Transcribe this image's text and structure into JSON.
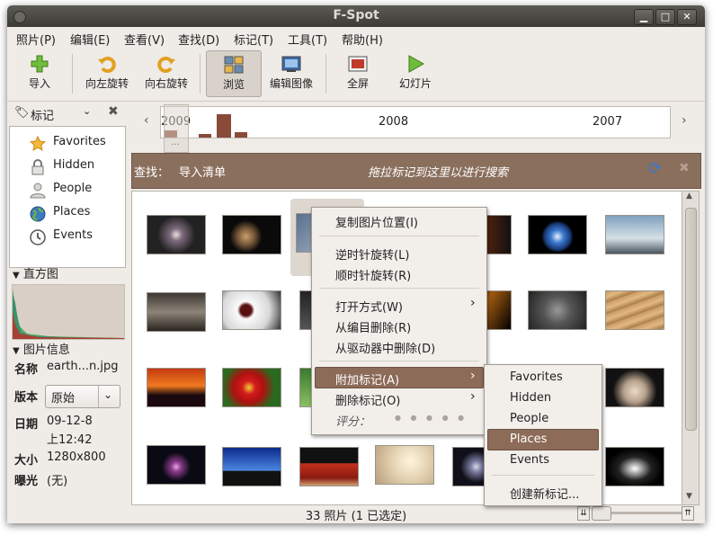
{
  "window": {
    "title": "F-Spot"
  },
  "menubar": [
    "照片(P)",
    "编辑(E)",
    "查看(V)",
    "查找(D)",
    "标记(T)",
    "工具(T)",
    "帮助(H)"
  ],
  "toolbar": {
    "import": "导入",
    "rotate_left": "向左旋转",
    "rotate_right": "向右旋转",
    "browse": "浏览",
    "edit_image": "编辑图像",
    "fullscreen": "全屏",
    "slideshow": "幻灯片"
  },
  "sidebar": {
    "header": "标记",
    "tags": [
      {
        "label": "Favorites",
        "icon": "star-icon"
      },
      {
        "label": "Hidden",
        "icon": "lock-icon"
      },
      {
        "label": "People",
        "icon": "people-icon"
      },
      {
        "label": "Places",
        "icon": "globe-icon"
      },
      {
        "label": "Events",
        "icon": "clock-icon"
      }
    ],
    "histogram_label": "直方图",
    "info_label": "图片信息",
    "info": {
      "name_label": "名称",
      "name_value": "earth...n.jpg",
      "version_label": "版本",
      "version_value": "原始",
      "date_label": "日期",
      "date_value": "09-12-8",
      "time_value": "上12:42",
      "size_label": "大小",
      "size_value": "1280x800",
      "exposure_label": "曝光",
      "exposure_value": "(无)"
    }
  },
  "timeline": {
    "years": [
      "2009",
      "2008",
      "2007"
    ],
    "marker": "..."
  },
  "findbar": {
    "label": "查找：",
    "import_list": "导入清单",
    "hint": "拖拉标记到这里以进行搜索"
  },
  "status": {
    "text": "33 照片 (1 已选定)"
  },
  "context_menu": {
    "items": [
      "复制图片位置(I)",
      "逆时针旋转(L)",
      "顺时针旋转(R)",
      "打开方式(W)",
      "从编目删除(R)",
      "从驱动器中删除(D)",
      "附加标记(A)",
      "删除标记(O)"
    ],
    "rating_label": "评分：",
    "rating_dots": "● ● ● ● ●"
  },
  "submenu": {
    "items": [
      "Favorites",
      "Hidden",
      "People",
      "Places",
      "Events"
    ],
    "create": "创建新标记..."
  },
  "colors": {
    "accent": "#8c6b58",
    "findbar": "#8a6f5d",
    "titlebar": "#3c3b37"
  }
}
